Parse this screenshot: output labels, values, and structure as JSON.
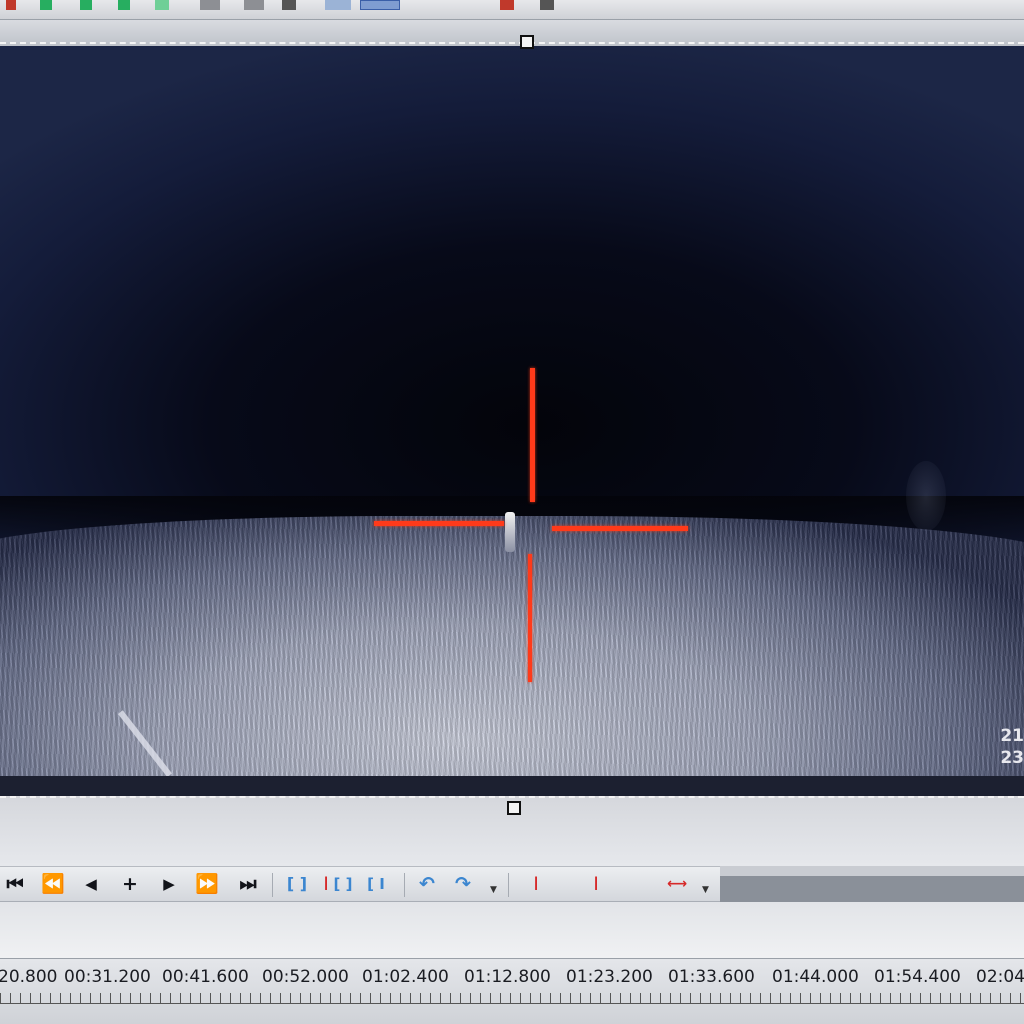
{
  "osd": {
    "line1": "21",
    "line2": "23"
  },
  "transport": {
    "go_start": "⏮",
    "rewind": "⏪",
    "step_back": "◀",
    "frame": "+",
    "play": "▶",
    "fast_forward": "⏩",
    "go_end": "⏭",
    "mark_in_out": "[ ]",
    "mark_in": "I",
    "mark_clip_a": "[ ]",
    "mark_clip_b": "[ I",
    "undo": "↶",
    "redo": "↷",
    "split_a": "I",
    "split_b": "I",
    "split_c": "⟷"
  },
  "timeline": {
    "ticks": [
      "20.800",
      "00:31.200",
      "00:41.600",
      "00:52.000",
      "01:02.400",
      "01:12.800",
      "01:23.200",
      "01:33.600",
      "01:44.000",
      "01:54.400",
      "02:04"
    ]
  },
  "colors": {
    "crosshair": "#ff3a1a",
    "accent_blue": "#3b86d0",
    "marker_red": "#d62a2a"
  }
}
